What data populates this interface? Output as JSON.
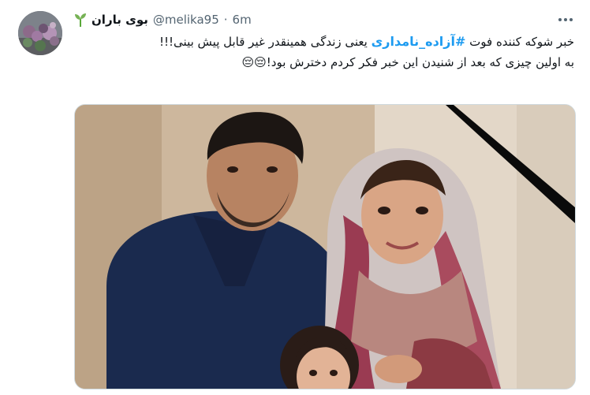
{
  "tweet": {
    "display_name": "بوی باران",
    "handle": "@melika95",
    "separator": "·",
    "time": "6m",
    "text_part1": "خبر شوکه کننده فوت ",
    "hashtag": "#آزاده_نامداری",
    "text_part2": " یعنی زندگی همینقدر غیر قابل پیش بینی!!!",
    "line2": "به اولین چیزی که بعد از شنیدن این خبر فکر کردم دخترش بود!😔😔"
  },
  "colors": {
    "text": "#0f1419",
    "secondary": "#536471",
    "link": "#1d9bf0",
    "border": "#cfd9de"
  },
  "icons": {
    "sprout": "sprout-icon",
    "more": "more-options-icon"
  }
}
